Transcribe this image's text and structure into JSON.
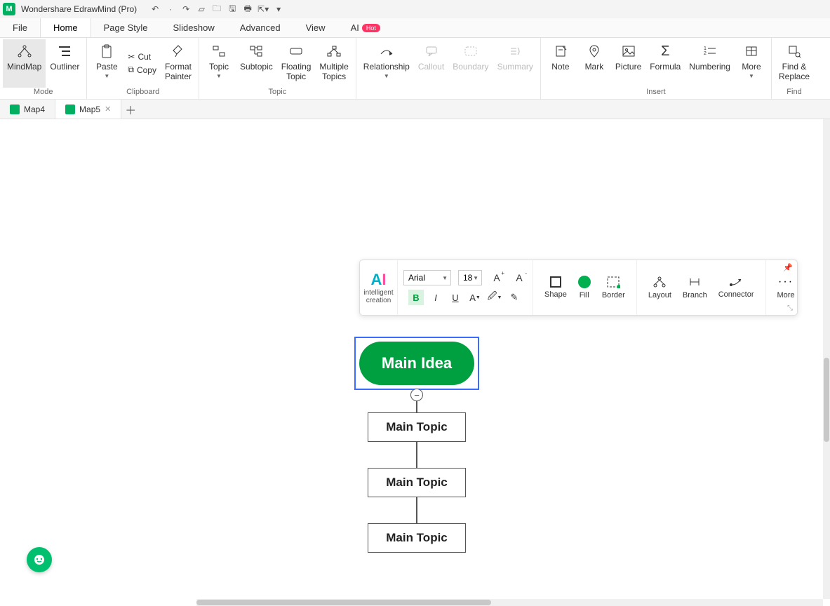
{
  "app": {
    "title": "Wondershare EdrawMind (Pro)"
  },
  "menu": {
    "items": [
      "File",
      "Home",
      "Page Style",
      "Slideshow",
      "Advanced",
      "View",
      "AI"
    ],
    "active": "Home",
    "hot_badge": "Hot"
  },
  "ribbon": {
    "mode": {
      "mindmap": "MindMap",
      "outliner": "Outliner",
      "group_label": "Mode"
    },
    "clipboard": {
      "paste": "Paste",
      "cut": "Cut",
      "copy": "Copy",
      "format_painter": "Format\nPainter",
      "group_label": "Clipboard"
    },
    "topic": {
      "topic": "Topic",
      "subtopic": "Subtopic",
      "floating": "Floating\nTopic",
      "multiple": "Multiple\nTopics",
      "group_label": "Topic"
    },
    "rel": {
      "relationship": "Relationship",
      "callout": "Callout",
      "boundary": "Boundary",
      "summary": "Summary"
    },
    "insert": {
      "note": "Note",
      "mark": "Mark",
      "picture": "Picture",
      "formula": "Formula",
      "numbering": "Numbering",
      "more": "More",
      "group_label": "Insert"
    },
    "find": {
      "label": "Find &\nReplace",
      "group_label": "Find"
    }
  },
  "tabs": {
    "items": [
      {
        "label": "Map4"
      },
      {
        "label": "Map5"
      }
    ],
    "active_index": 1
  },
  "float": {
    "ai": "intelligent\ncreation",
    "font": "Arial",
    "size": "18",
    "inc": "A",
    "dec": "A",
    "shape": "Shape",
    "fill": "Fill",
    "border": "Border",
    "layout": "Layout",
    "branch": "Branch",
    "connector": "Connector",
    "more": "More"
  },
  "mindmap": {
    "root": "Main Idea",
    "topics": [
      "Main Topic",
      "Main Topic",
      "Main Topic"
    ]
  }
}
